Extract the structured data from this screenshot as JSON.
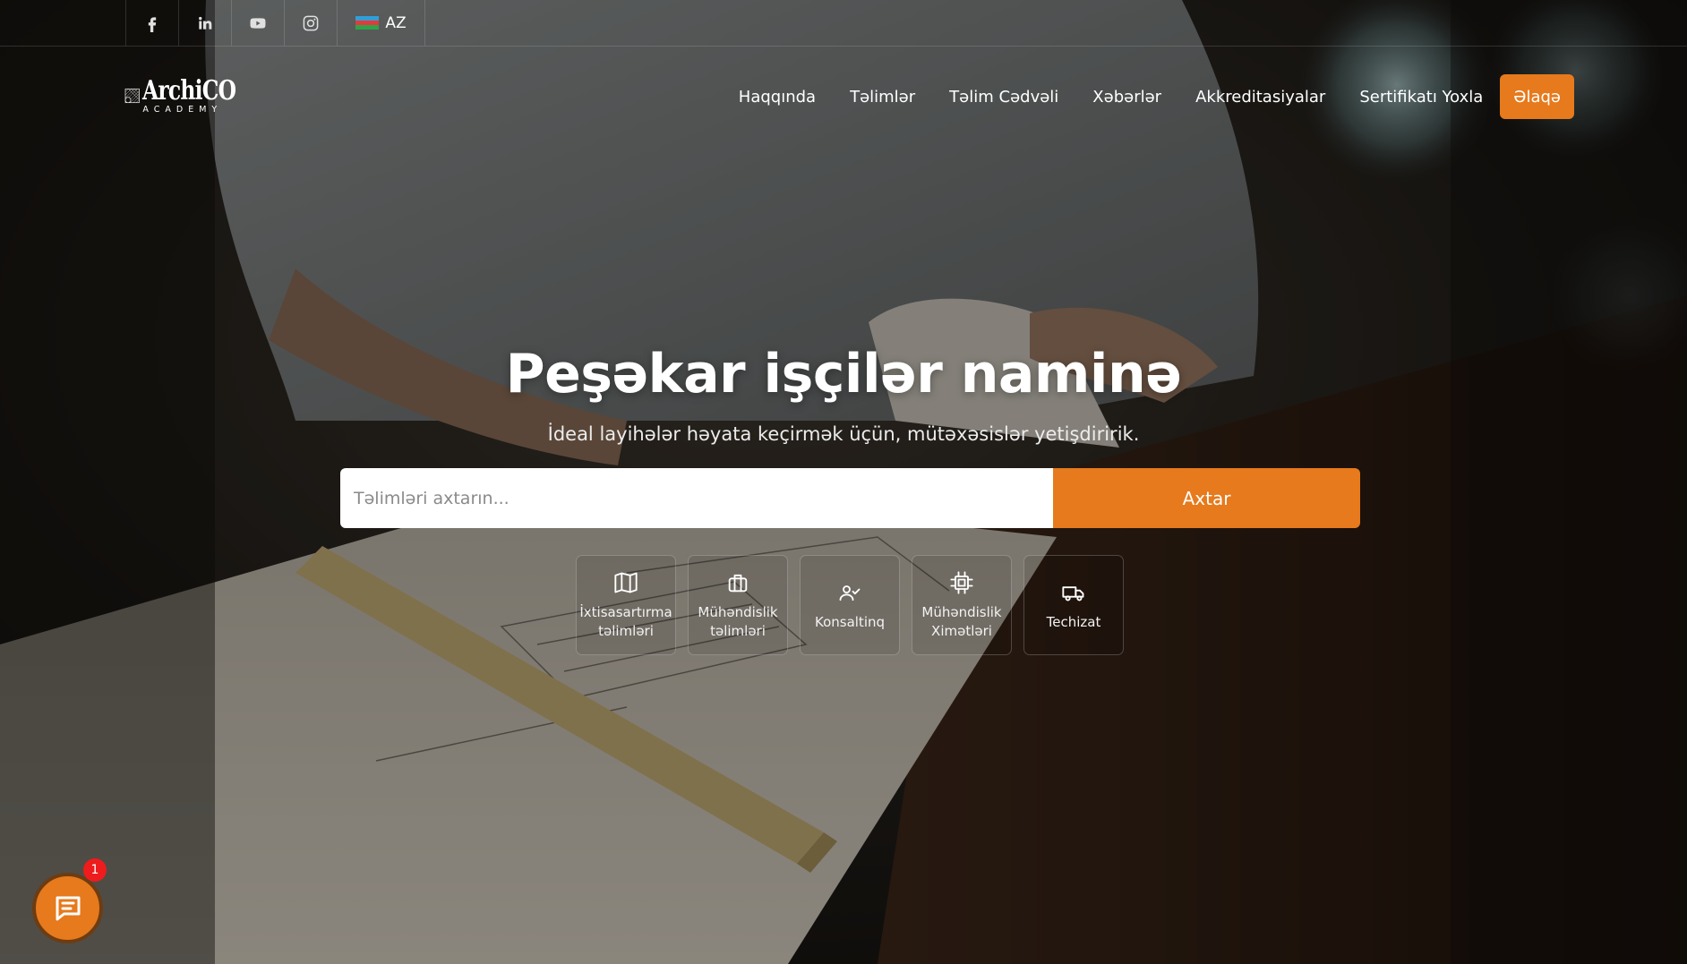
{
  "topbar": {
    "socials": [
      {
        "name": "facebook-icon"
      },
      {
        "name": "linkedin-icon"
      },
      {
        "name": "youtube-icon"
      },
      {
        "name": "instagram-icon"
      }
    ],
    "language": {
      "label": "AZ",
      "flag": "azerbaijan-flag-icon"
    }
  },
  "logo": {
    "title": "ArchiCO",
    "subtitle": "ACADEMY"
  },
  "nav": {
    "items": [
      "Haqqında",
      "Təlimlər",
      "Təlim Cədvəli",
      "Xəbərlər",
      "Akkreditasiyalar",
      "Sertifikatı Yoxla"
    ],
    "cta": "Əlaqə"
  },
  "hero": {
    "title": "Peşəkar işçilər naminə",
    "subtitle": "İdeal layihələr həyata keçirmək üçün, mütəxəsislər yetişdiririk."
  },
  "search": {
    "placeholder": "Təlimləri axtarın...",
    "button": "Axtar"
  },
  "categories": [
    {
      "icon": "map-icon",
      "label_line1": "İxtisasartırma",
      "label_line2": "təlimləri"
    },
    {
      "icon": "briefcase-icon",
      "label_line1": "Mühəndislik",
      "label_line2": "təlimləri"
    },
    {
      "icon": "user-check-icon",
      "label_line1": "Konsaltinq",
      "label_line2": ""
    },
    {
      "icon": "cpu-icon",
      "label_line1": "Mühəndislik",
      "label_line2": "Ximətləri"
    },
    {
      "icon": "truck-icon",
      "label_line1": "Techizat",
      "label_line2": ""
    }
  ],
  "chat": {
    "badge_count": "1",
    "icon": "chat-icon"
  },
  "colors": {
    "accent": "#e67a1c",
    "badge": "#ee1c1c"
  }
}
